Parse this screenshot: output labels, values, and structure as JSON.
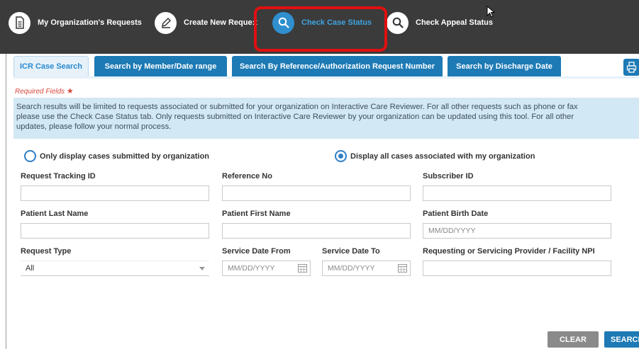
{
  "nav": {
    "items": [
      {
        "label": "My Organization's Requests",
        "icon": "document-icon"
      },
      {
        "label": "Create New Reque:t",
        "icon": "pencil-icon"
      },
      {
        "label": "Check Case Status",
        "icon": "search-icon",
        "active": true
      },
      {
        "label": "Check Appeal Status",
        "icon": "search-icon"
      }
    ],
    "highlight_color": "#e01010"
  },
  "tabs": [
    {
      "label": "ICR Case Search",
      "active": true
    },
    {
      "label": "Search by Member/Date range"
    },
    {
      "label": "Search By Reference/Authorization Request Number"
    },
    {
      "label": "Search by Discharge Date"
    }
  ],
  "required_text": "Required Fields",
  "required_star": "★",
  "info": {
    "line1": "Search results will be limited to requests associated or submitted for your organization on Interactive Care Reviewer. For all other requests such as phone or fax",
    "line2": "please use the Check Case Status tab. Only requests submitted on Interactive Care Reviewer by your organization can be updated using this tool. For all other",
    "line3": "updates, please follow your normal process."
  },
  "radios": {
    "org_only": "Only display cases submitted by organization",
    "all_cases": "Display all cases associated with my organization",
    "selected": "all_cases"
  },
  "fields": {
    "request_tracking_id": {
      "label": "Request Tracking ID",
      "value": ""
    },
    "reference_no": {
      "label": "Reference No",
      "value": ""
    },
    "subscriber_id": {
      "label": "Subscriber ID",
      "value": ""
    },
    "patient_last_name": {
      "label": "Patient Last Name",
      "value": ""
    },
    "patient_first_name": {
      "label": "Patient First Name",
      "value": ""
    },
    "patient_birth_date": {
      "label": "Patient Birth Date",
      "placeholder": "MM/DD/YYYY"
    },
    "request_type": {
      "label": "Request Type",
      "value": "All"
    },
    "service_date_from": {
      "label": "Service Date From",
      "placeholder": "MM/DD/YYYY"
    },
    "service_date_to": {
      "label": "Service Date To",
      "placeholder": "MM/DD/YYYY"
    },
    "provider_npi": {
      "label": "Requesting or Servicing Provider / Facility NPI",
      "value": ""
    }
  },
  "buttons": {
    "clear": "CLEAR",
    "search": "SEARCH"
  },
  "colors": {
    "topbar": "#3b3b3b",
    "accent": "#1d7ab5",
    "active_nav": "#2f8fcf",
    "info_bg": "#d2e8f4",
    "required": "#d7463b"
  }
}
